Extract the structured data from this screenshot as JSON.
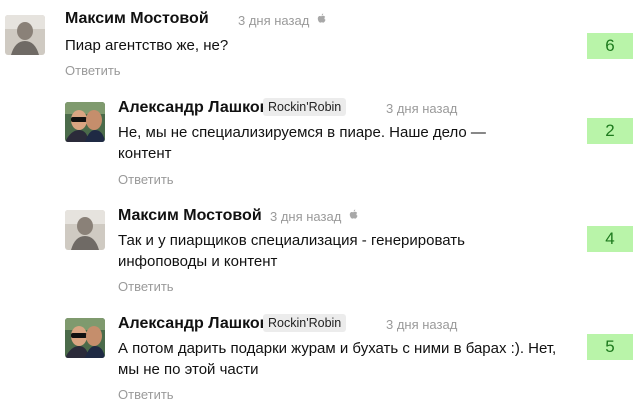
{
  "comments": [
    {
      "author": "Максим Мостовой",
      "badge": "",
      "time": "3 дня назад",
      "platform_icon": "apple-icon",
      "text": "Пиар агентство же, не?",
      "reply_label": "Ответить",
      "score": "6"
    },
    {
      "author": "Александр Лашков",
      "badge": "Rockin'Robin",
      "time": "3 дня назад",
      "platform_icon": "",
      "text": "Не, мы не специализируемся в пиаре. Наше дело — контент",
      "reply_label": "Ответить",
      "score": "2"
    },
    {
      "author": "Максим Мостовой",
      "badge": "",
      "time": "3 дня назад",
      "platform_icon": "apple-icon",
      "text": "Так и у пиарщиков специализация - генерировать инфоповоды и контент",
      "reply_label": "Ответить",
      "score": "4"
    },
    {
      "author": "Александр Лашков",
      "badge": "Rockin'Robin",
      "time": "3 дня назад",
      "platform_icon": "",
      "text": "А потом дарить подарки журам и бухать с ними в барах :). Нет, мы не по этой части",
      "reply_label": "Ответить",
      "score": "5"
    }
  ],
  "colors": {
    "score_bg": "#b9f4a9",
    "score_text": "#1e7a1e",
    "muted_text": "#9a9a9a",
    "badge_bg": "#ececec"
  }
}
